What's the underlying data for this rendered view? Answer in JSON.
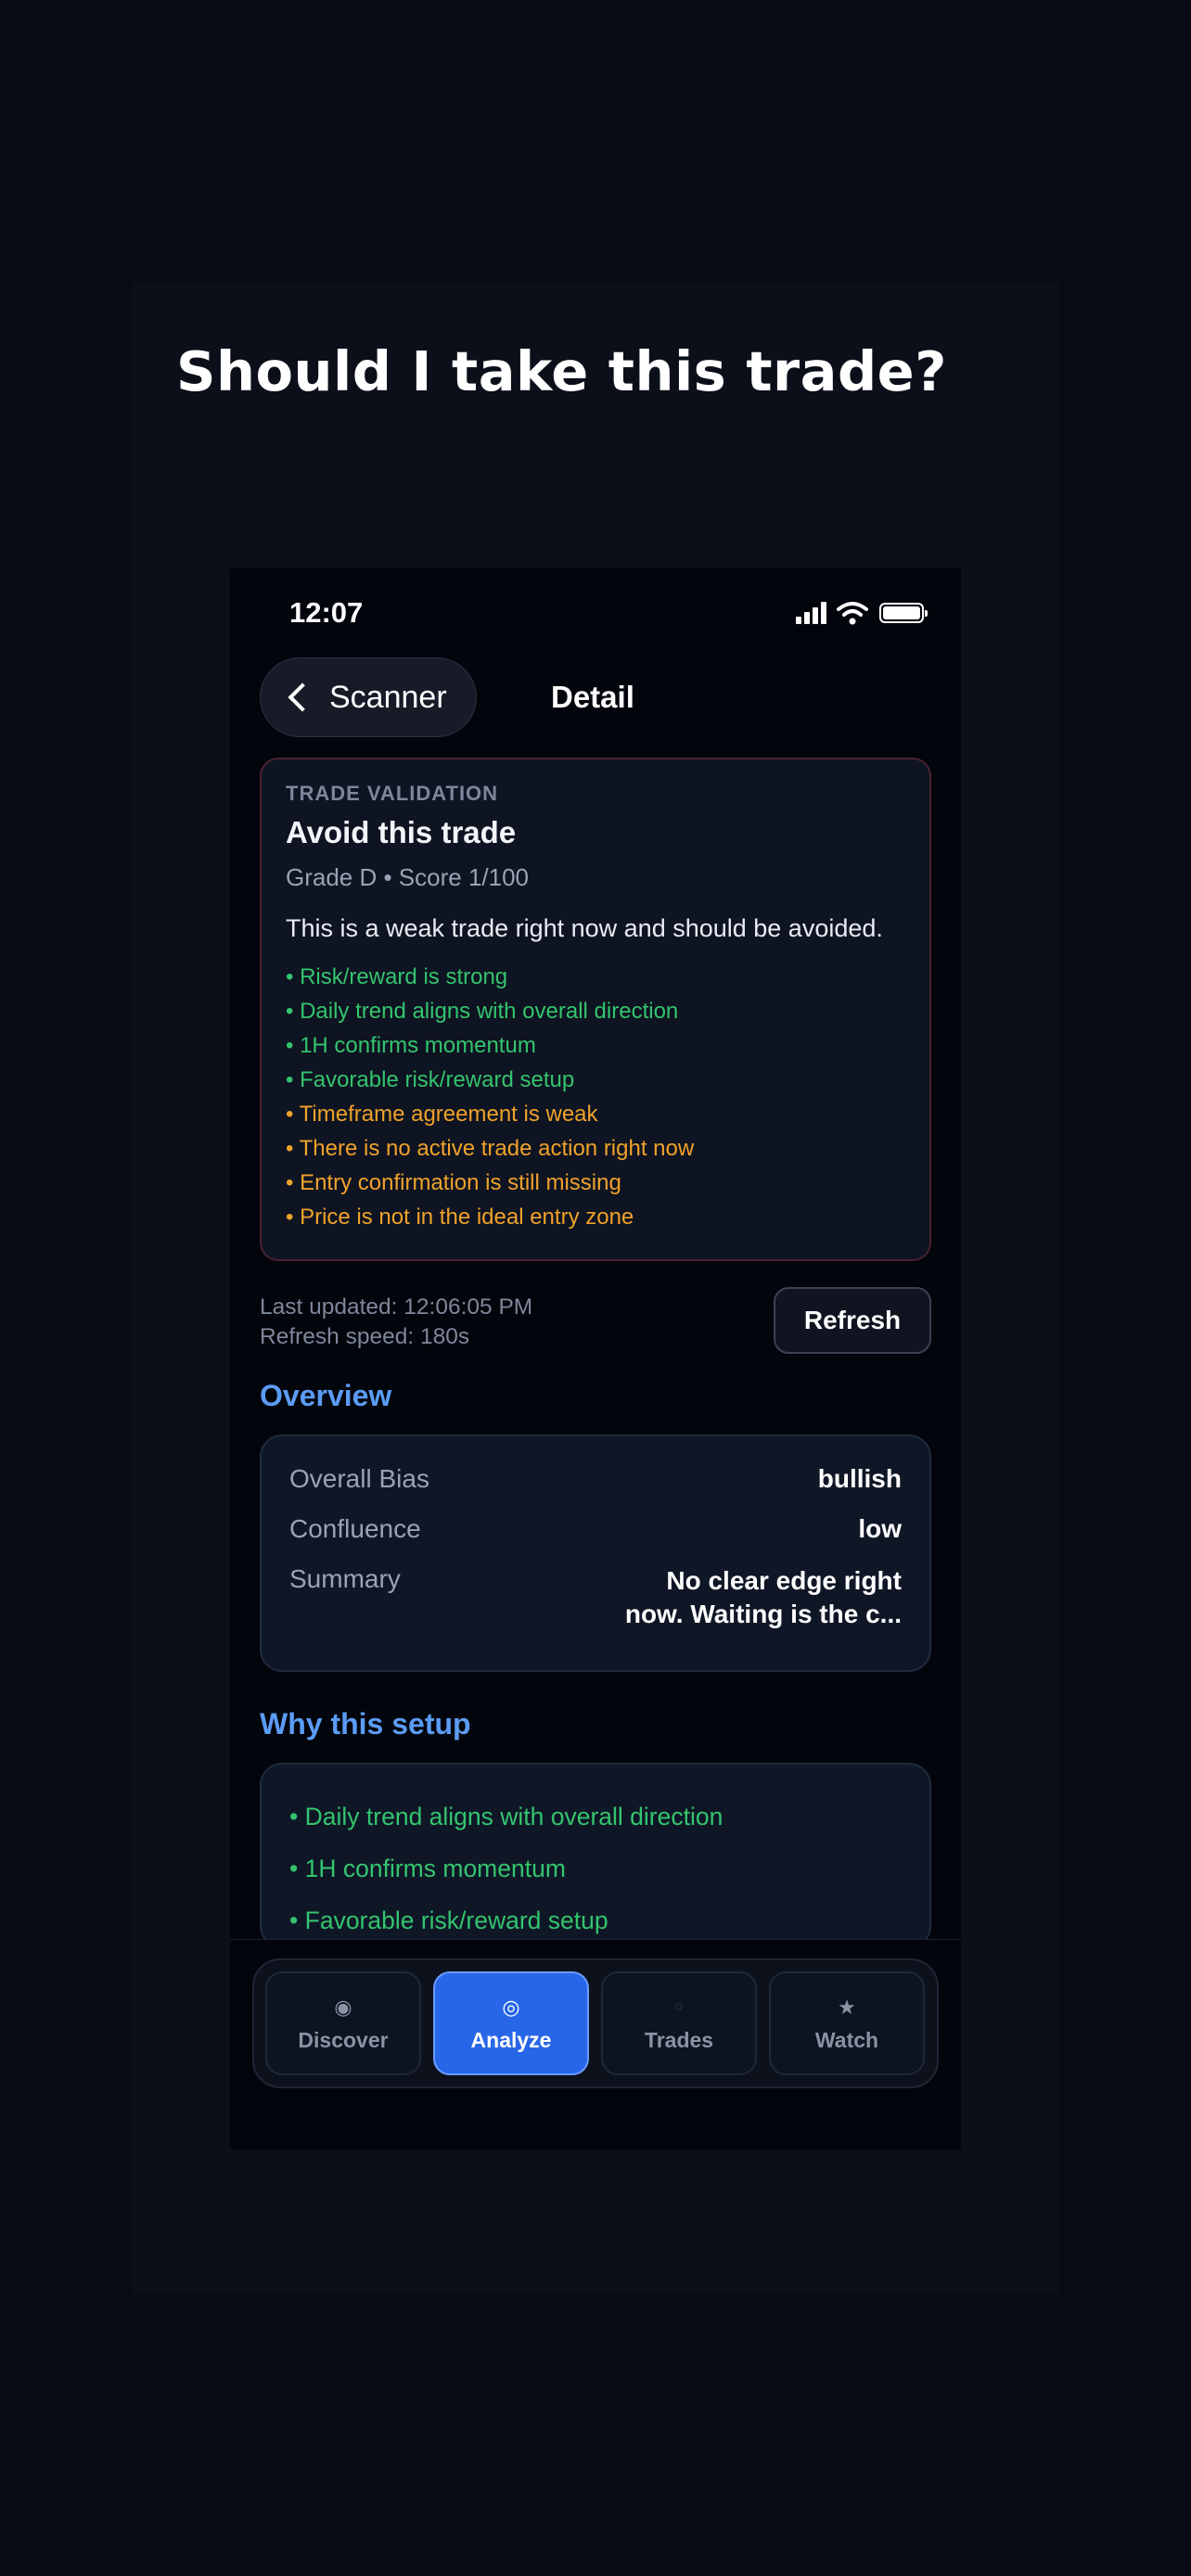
{
  "headline": "Should I take this trade?",
  "status": {
    "time": "12:07"
  },
  "nav": {
    "back_label": "Scanner",
    "title": "Detail"
  },
  "validation": {
    "eyebrow": "TRADE VALIDATION",
    "title": "Avoid this trade",
    "grade": "Grade D • Score 1/100",
    "description": "This is a weak trade right now and should be avoided.",
    "points": [
      {
        "text": "Risk/reward is strong",
        "tone": "good"
      },
      {
        "text": "Daily trend aligns with overall direction",
        "tone": "good"
      },
      {
        "text": "1H confirms momentum",
        "tone": "good"
      },
      {
        "text": "Favorable risk/reward setup",
        "tone": "good"
      },
      {
        "text": "Timeframe agreement is weak",
        "tone": "warn"
      },
      {
        "text": "There is no active trade action right now",
        "tone": "warn"
      },
      {
        "text": "Entry confirmation is still missing",
        "tone": "warn"
      },
      {
        "text": "Price is not in the ideal entry zone",
        "tone": "warn"
      }
    ],
    "colors": {
      "good": "#34c46e",
      "warn": "#f0a22b",
      "border": "#4a2230"
    }
  },
  "update": {
    "last_updated": "Last updated: 12:06:05 PM",
    "refresh_speed": "Refresh speed: 180s",
    "refresh_label": "Refresh"
  },
  "overview": {
    "heading": "Overview",
    "rows": [
      {
        "key": "Overall Bias",
        "value": "bullish"
      },
      {
        "key": "Confluence",
        "value": "low"
      },
      {
        "key": "Summary",
        "value": "No clear edge right now. Waiting is the c..."
      }
    ]
  },
  "why": {
    "heading": "Why this setup",
    "items": [
      "Daily trend aligns with overall direction",
      "1H confirms momentum",
      "Favorable risk/reward setup"
    ]
  },
  "tabs": [
    {
      "label": "Discover",
      "icon": "◉",
      "icon_name": "discover-icon",
      "active": false
    },
    {
      "label": "Analyze",
      "icon": "◎",
      "icon_name": "analyze-icon",
      "active": true
    },
    {
      "label": "Trades",
      "icon": "○",
      "icon_name": "trades-icon",
      "active": false
    },
    {
      "label": "Watch",
      "icon": "★",
      "icon_name": "watch-star-icon",
      "active": false
    }
  ],
  "accent": "#2866e8"
}
